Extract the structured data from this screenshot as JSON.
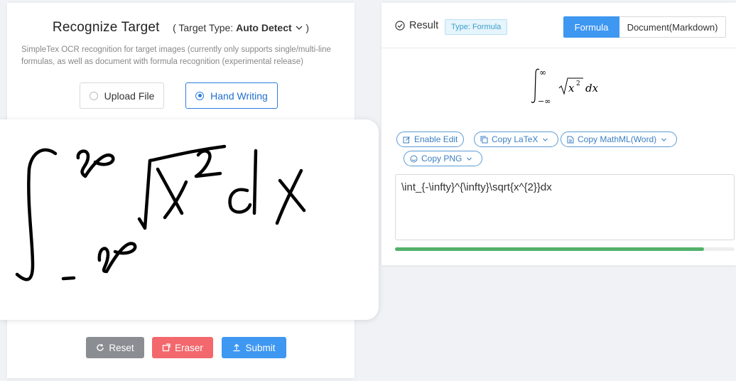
{
  "recognize": {
    "title": "Recognize Target",
    "type_prefix": "( Target Type: ",
    "type_value": "Auto Detect",
    "type_suffix": ")",
    "description": "SimpleTex OCR recognition for target images (currently only supports single/multi-line formulas, as well as document with formula recognition (experimental release)",
    "modes": [
      {
        "label": "Upload File",
        "selected": false
      },
      {
        "label": "Hand Writing",
        "selected": true
      }
    ]
  },
  "actions": {
    "reset": "Reset",
    "eraser": "Eraser",
    "submit": "Submit"
  },
  "result": {
    "title": "Result",
    "type_badge": "Type: Formula",
    "tabs": [
      "Formula",
      "Document(Markdown)"
    ],
    "active_tab": "Formula",
    "rendered": {
      "lower": "−∞",
      "upper": "∞",
      "base": "x",
      "exponent": "2",
      "differential": "dx"
    },
    "tools": {
      "enable_edit": "Enable Edit",
      "copy_latex": "Copy LaTeX",
      "copy_mathml": "Copy MathML(Word)",
      "copy_png": "Copy PNG"
    },
    "latex": "\\int_{-\\infty}^{\\infty}\\sqrt{x^{2}}dx",
    "progress": 0.91
  },
  "colors": {
    "primary": "#3e97f1",
    "success": "#52b16a",
    "danger": "#f2686c",
    "neutral": "#8a8d92"
  },
  "icons": [
    "chevron-down-icon",
    "refresh-icon",
    "eraser-icon",
    "upload-icon",
    "check-circle-icon",
    "edit-icon",
    "copy-icon",
    "document-icon",
    "image-icon"
  ]
}
